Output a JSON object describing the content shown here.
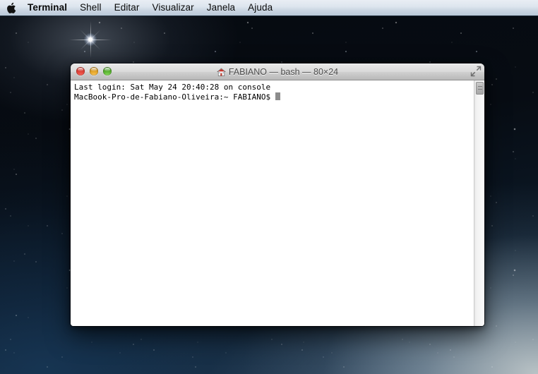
{
  "menubar": {
    "apple_icon": "apple-logo-icon",
    "items": [
      {
        "label": "Terminal",
        "bold": true
      },
      {
        "label": "Shell",
        "bold": false
      },
      {
        "label": "Editar",
        "bold": false
      },
      {
        "label": "Visualizar",
        "bold": false
      },
      {
        "label": "Janela",
        "bold": false
      },
      {
        "label": "Ajuda",
        "bold": false
      }
    ]
  },
  "window": {
    "title": "FABIANO — bash — 80×24",
    "title_icon": "home-icon",
    "controls": {
      "close_label": "close",
      "minimize_label": "minimize",
      "zoom_label": "zoom",
      "fullscreen_label": "fullscreen"
    }
  },
  "terminal": {
    "line1": "Last login: Sat May 24 20:40:28 on console",
    "line2": "MacBook-Pro-de-Fabiano-Oliveira:~ FABIANO$ ",
    "cursor": "block-cursor"
  },
  "colors": {
    "menubar_text": "#0a0a0a",
    "title_text": "#4a4a4a",
    "terminal_bg": "#ffffff",
    "terminal_fg": "#000000",
    "cursor": "#8c8c8c",
    "light_red": "#e4463c",
    "light_yellow": "#e8a92c",
    "light_green": "#5eb834"
  }
}
